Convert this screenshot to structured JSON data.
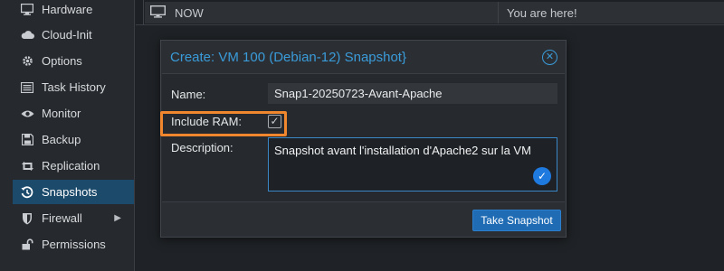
{
  "sidebar": {
    "items": [
      {
        "label": "Hardware",
        "icon": "monitor-icon"
      },
      {
        "label": "Cloud-Init",
        "icon": "cloud-icon"
      },
      {
        "label": "Options",
        "icon": "gear-icon"
      },
      {
        "label": "Task History",
        "icon": "list-icon"
      },
      {
        "label": "Monitor",
        "icon": "eye-icon"
      },
      {
        "label": "Backup",
        "icon": "floppy-icon"
      },
      {
        "label": "Replication",
        "icon": "retweet-icon"
      },
      {
        "label": "Snapshots",
        "icon": "history-icon",
        "active": true
      },
      {
        "label": "Firewall",
        "icon": "shield-icon"
      },
      {
        "label": "Permissions",
        "icon": "unlock-icon"
      }
    ]
  },
  "topbar": {
    "now_label": "NOW",
    "you_are_here": "You are here!"
  },
  "dialog": {
    "title": "Create: VM 100 (Debian-12) Snapshot}",
    "name_label": "Name:",
    "name_value": "Snap1-20250723-Avant-Apache",
    "include_ram_label": "Include RAM:",
    "include_ram_checked": true,
    "description_label": "Description:",
    "description_value": "Snapshot avant l'installation d'Apache2 sur la VM",
    "take_button": "Take Snapshot"
  },
  "colors": {
    "accent": "#3a9bd9",
    "highlight": "#f0862d",
    "active_nav": "#1c4a6b",
    "button": "#1f6cb5"
  }
}
